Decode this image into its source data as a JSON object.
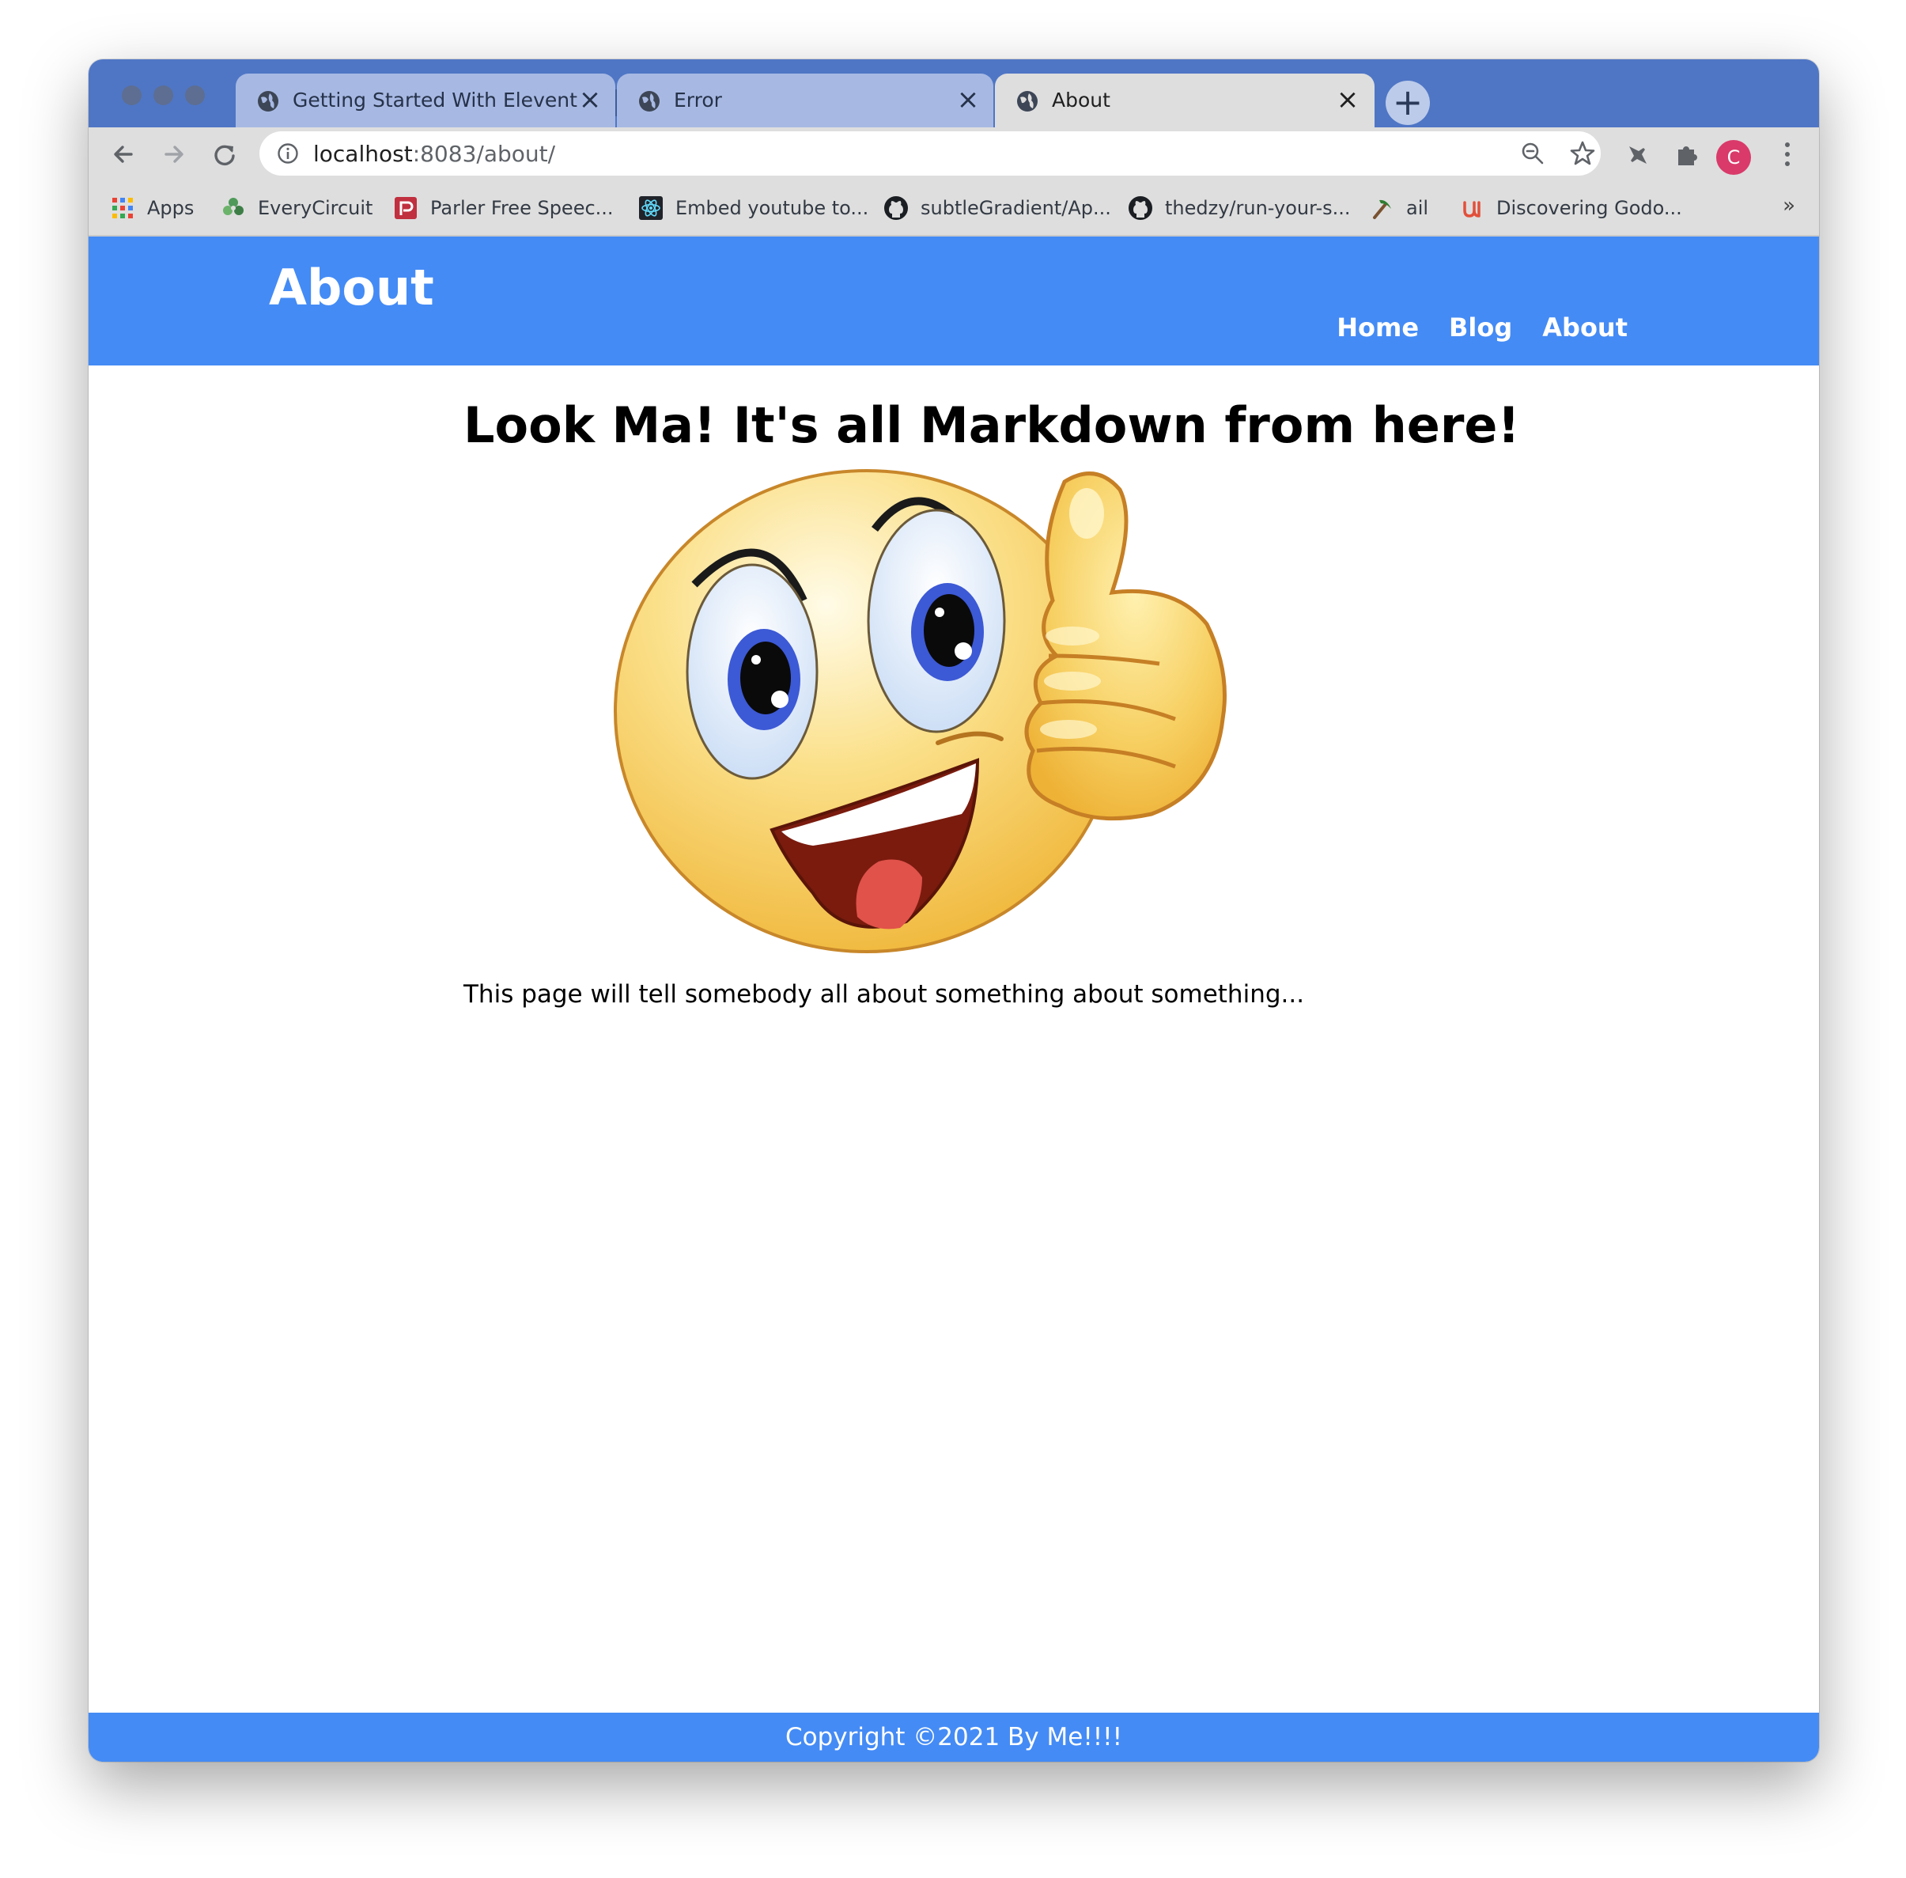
{
  "browser": {
    "tabs": [
      {
        "title": "Getting Started With Eleventy F",
        "active": false
      },
      {
        "title": "Error",
        "active": false
      },
      {
        "title": "About",
        "active": true
      }
    ],
    "new_tab_label": "+",
    "address": {
      "host": "localhost",
      "path": ":8083/about/"
    },
    "avatar_letter": "C",
    "bookmarks": [
      {
        "label": "Apps",
        "icon": "apps-grid-icon"
      },
      {
        "label": "EveryCircuit",
        "icon": "everycircuit-icon"
      },
      {
        "label": "Parler Free Speec...",
        "icon": "parler-icon"
      },
      {
        "label": "Embed youtube to...",
        "icon": "react-icon"
      },
      {
        "label": "subtleGradient/Ap...",
        "icon": "github-icon"
      },
      {
        "label": "thedzy/run-your-s...",
        "icon": "github-icon"
      },
      {
        "label": "ail",
        "icon": "pickaxe-icon"
      },
      {
        "label": "Discovering Godo...",
        "icon": "udemy-icon"
      }
    ],
    "bookmarks_more": "»",
    "colors": {
      "tabstrip": "#4f76c5",
      "toolbar": "#dedede",
      "inactive_tab": "#a7b9e3"
    }
  },
  "site": {
    "title": "About",
    "nav": [
      "Home",
      "Blog",
      "About"
    ],
    "heading": "Look Ma! It's all Markdown from here!",
    "paragraph": "This page will tell somebody all about something about something...",
    "footer": "Copyright ©2021 By Me!!!!",
    "colors": {
      "header": "#448bf5",
      "footer": "#448bf5"
    }
  }
}
